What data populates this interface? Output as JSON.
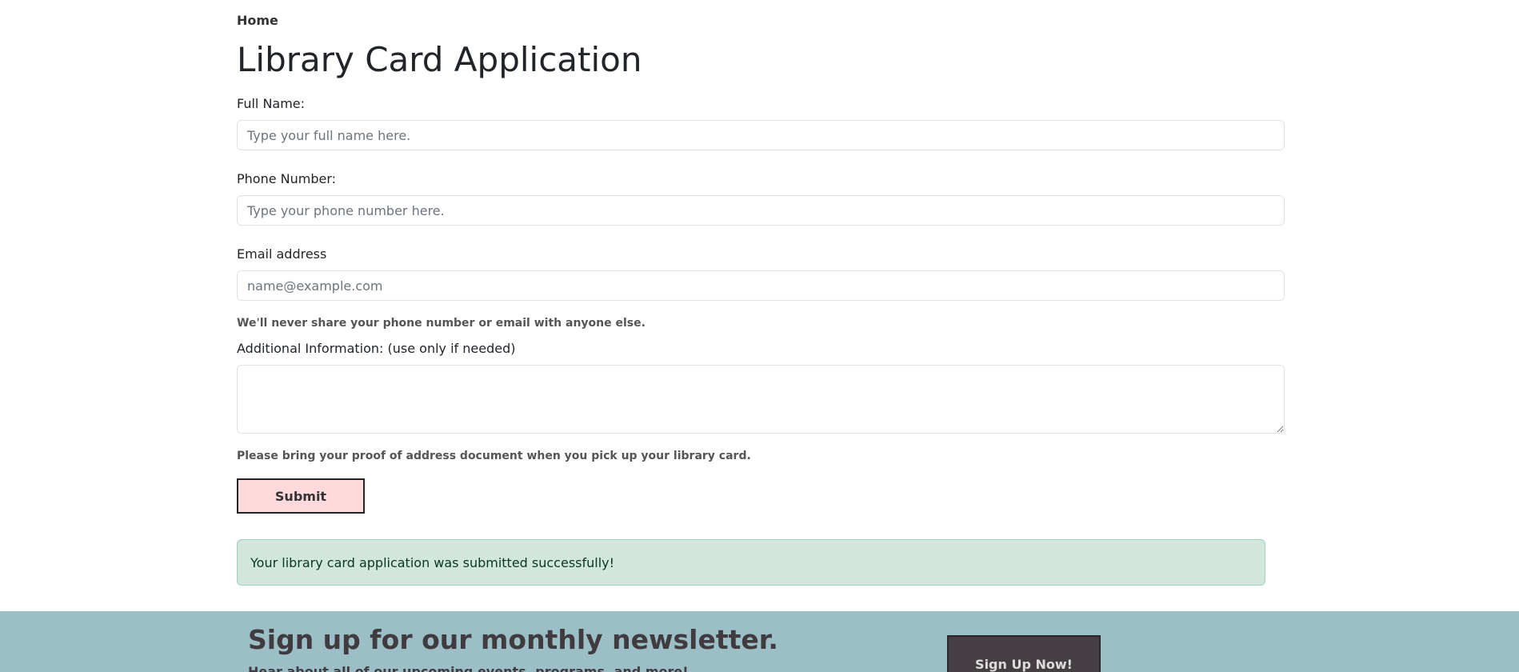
{
  "nav": {
    "home_label": "Home"
  },
  "page": {
    "title": "Library Card Application"
  },
  "form": {
    "full_name": {
      "label": "Full Name:",
      "placeholder": "Type your full name here.",
      "value": ""
    },
    "phone": {
      "label": "Phone Number:",
      "placeholder": "Type your phone number here.",
      "value": ""
    },
    "email": {
      "label": "Email address",
      "placeholder": "name@example.com",
      "value": ""
    },
    "privacy_note": "We'll never share your phone number or email with anyone else.",
    "additional_info": {
      "label": "Additional Information: (use only if needed)",
      "value": ""
    },
    "proof_note": "Please bring your proof of address document when you pick up your library card.",
    "submit_label": "Submit"
  },
  "alert": {
    "message": "Your library card application was submitted successfully!",
    "color": "#d1e7dd"
  },
  "newsletter": {
    "title": "Sign up for our monthly newsletter.",
    "subtitle": "Hear about all of our upcoming events, programs, and more!",
    "button_label": "Sign Up Now!",
    "background_color": "#9bbec7"
  },
  "colors": {
    "submit_button": "#ffd9db",
    "signup_button": "#453f44"
  }
}
